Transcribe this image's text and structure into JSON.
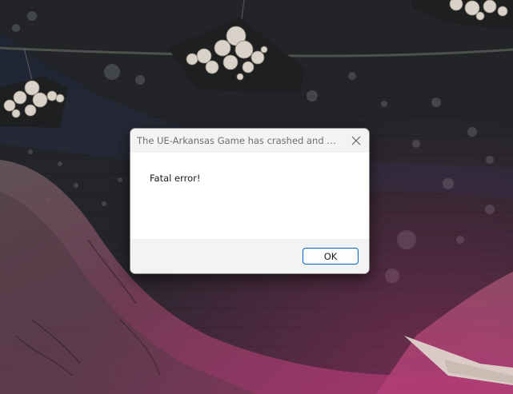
{
  "dialog": {
    "title": "The UE-Arkansas Game has crashed and will cl...",
    "message": "Fatal error!",
    "ok_label": "OK",
    "close_icon": "close-icon"
  },
  "colors": {
    "accent": "#0067c0",
    "dialog_body": "#ffffff",
    "dialog_chrome": "#f3f3f3"
  }
}
